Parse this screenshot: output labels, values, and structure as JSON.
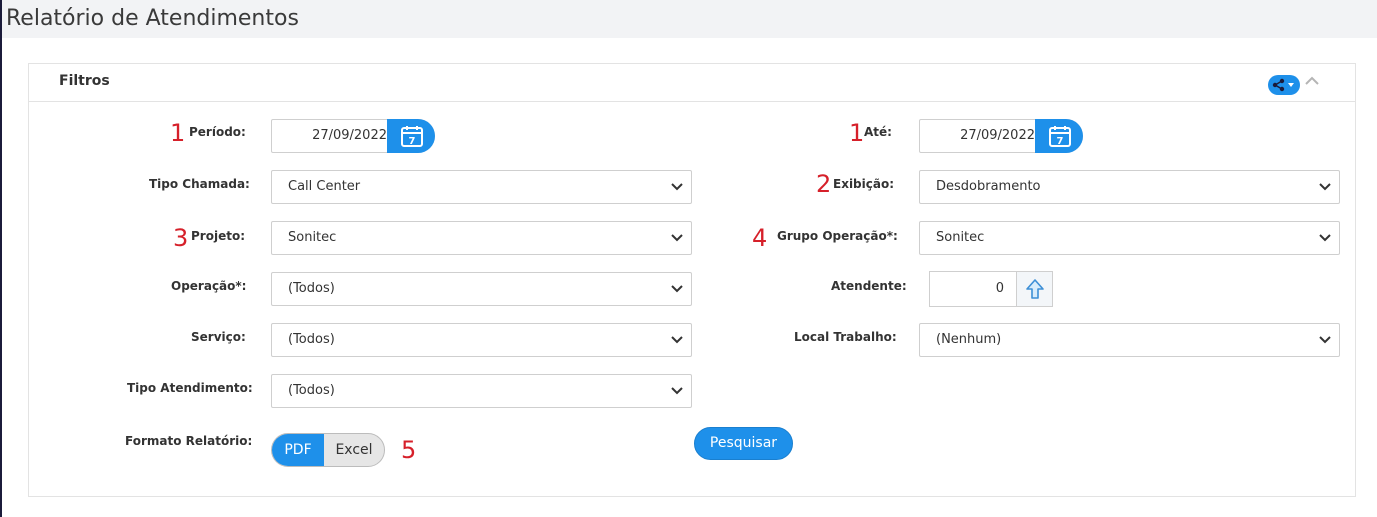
{
  "page": {
    "title": "Relatório de Atendimentos"
  },
  "panel": {
    "title": "Filtros"
  },
  "markers": {
    "periodo": "1",
    "ate": "1",
    "exibicao": "2",
    "projeto": "3",
    "grupo": "4",
    "formato": "5"
  },
  "fields": {
    "periodo": {
      "label": "Período:",
      "value": "27/09/2022"
    },
    "ate": {
      "label": "Até:",
      "value": "27/09/2022"
    },
    "tipo_chamada": {
      "label": "Tipo Chamada:",
      "value": "Call Center"
    },
    "exibicao": {
      "label": "Exibição:",
      "value": "Desdobramento"
    },
    "projeto": {
      "label": "Projeto:",
      "value": "Sonitec"
    },
    "grupo_operacao": {
      "label": "Grupo Operação*:",
      "value": "Sonitec"
    },
    "operacao": {
      "label": "Operação*:",
      "value": "(Todos)"
    },
    "atendente": {
      "label": "Atendente:",
      "value": "0"
    },
    "servico": {
      "label": "Serviço:",
      "value": "(Todos)"
    },
    "local_trabalho": {
      "label": "Local Trabalho:",
      "value": "(Nenhum)"
    },
    "tipo_atendimento": {
      "label": "Tipo Atendimento:",
      "value": "(Todos)"
    },
    "formato": {
      "label": "Formato Relatório:",
      "options": [
        "PDF",
        "Excel"
      ],
      "selected": "PDF"
    }
  },
  "actions": {
    "search_label": "Pesquisar"
  },
  "icons": {
    "calendar": "calendar-icon",
    "share": "share-icon",
    "up_arrow": "arrow-up-icon",
    "chevron": "chevron-down-icon"
  },
  "colors": {
    "accent": "#1e90ea",
    "marker": "#d6202a",
    "header_band": "#f2f3f5"
  }
}
